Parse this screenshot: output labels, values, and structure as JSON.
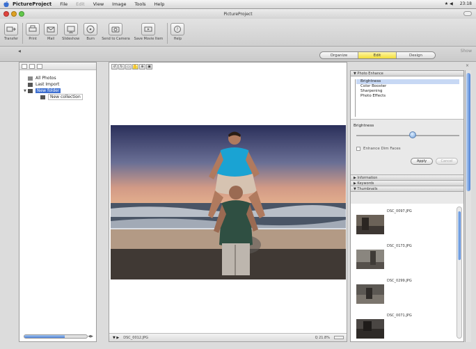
{
  "menubar": {
    "app_name": "PictureProject",
    "items": [
      "File",
      "Edit",
      "View",
      "Image",
      "Tools",
      "Help"
    ],
    "status_left": "★ ◀",
    "clock": "23:18"
  },
  "window": {
    "title": "PictureProject"
  },
  "toolbar": {
    "buttons": [
      {
        "label": "Transfer",
        "icon": "transfer-icon"
      },
      {
        "label": "Print",
        "icon": "print-icon"
      },
      {
        "label": "Mail",
        "icon": "mail-icon"
      },
      {
        "label": "Slideshow",
        "icon": "slideshow-icon"
      },
      {
        "label": "Burn",
        "icon": "burn-icon"
      },
      {
        "label": "Send to Camera",
        "icon": "send-to-camera-icon"
      },
      {
        "label": "Save Movie Item",
        "icon": "save-movie-icon"
      },
      {
        "label": "Help",
        "icon": "help-icon"
      }
    ]
  },
  "modes": {
    "tabs": [
      "Organize",
      "Edit",
      "Design"
    ],
    "active": "Edit",
    "right_label": "Show"
  },
  "left_panel": {
    "tree": [
      {
        "label": "All Photos",
        "level": 1,
        "selected": false
      },
      {
        "label": "Last Import",
        "level": 1,
        "selected": false
      },
      {
        "label": "New folder",
        "level": 1,
        "selected": true,
        "expanded": true
      },
      {
        "label": "New collection",
        "level": 2,
        "selected": false
      }
    ]
  },
  "center": {
    "filename": "DSC_0012.JPG",
    "zoom": "Q 21.8%"
  },
  "right_panel": {
    "photo_enhance_header": "▼ Photo Enhance",
    "enhance_items": [
      "Brightness",
      "Color Booster",
      "Sharpening",
      "Photo Effects"
    ],
    "selected_enhance": "Brightness",
    "adjust_label": "Brightness",
    "slider_level": 0.55,
    "checkbox_label": "Enhance Dim Faces",
    "apply_label": "Apply",
    "cancel_label": "Cancel",
    "information_header": "▶ Information",
    "keywords_header": "▶ Keywords",
    "thumbnails_header": "▼ Thumbnails",
    "thumbnails": [
      "DSC_0097.JPG",
      "DSC_0173.JPG",
      "DSC_0299.JPG",
      "DSC_0071.JPG"
    ]
  }
}
